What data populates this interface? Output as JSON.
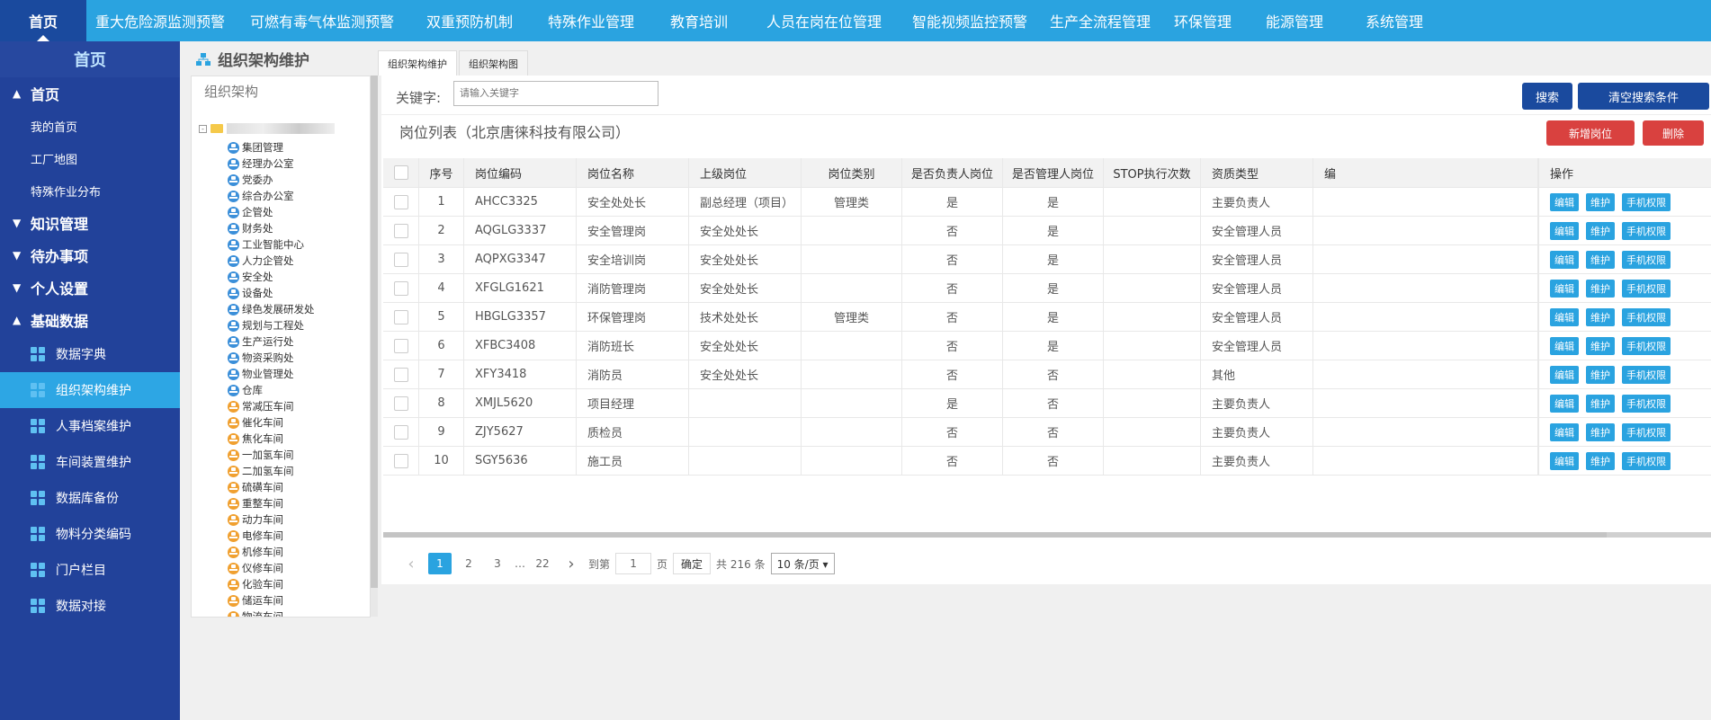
{
  "topnav": {
    "items": [
      "首页",
      "重大危险源监测预警",
      "可燃有毒气体监测预警",
      "双重预防机制",
      "特殊作业管理",
      "教育培训",
      "人员在岗在位管理",
      "智能视频监控预警",
      "生产全流程管理",
      "环保管理",
      "能源管理",
      "系统管理"
    ]
  },
  "sidebar": {
    "home": "首页",
    "group_home": "首页",
    "group_home_arrow": "▲",
    "subs": [
      "我的首页",
      "工厂地图",
      "特殊作业分布"
    ],
    "groups": [
      {
        "arrow": "▼",
        "label": "知识管理"
      },
      {
        "arrow": "▼",
        "label": "待办事项"
      },
      {
        "arrow": "▼",
        "label": "个人设置"
      },
      {
        "arrow": "▲",
        "label": "基础数据"
      }
    ],
    "items": [
      {
        "label": "数据字典",
        "icon": "dictionary-icon"
      },
      {
        "label": "组织架构维护",
        "icon": "org-chart-icon"
      },
      {
        "label": "人事档案维护",
        "icon": "folder-icon"
      },
      {
        "label": "车间装置维护",
        "icon": "building-icon"
      },
      {
        "label": "数据库备份",
        "icon": "bar-chart-icon"
      },
      {
        "label": "物料分类编码",
        "icon": "grid-icon"
      },
      {
        "label": "门户栏目",
        "icon": "list-icon"
      },
      {
        "label": "数据对接",
        "icon": "grid-icon"
      }
    ],
    "active_item_index": 1
  },
  "tree": {
    "panel_title": "组织架构维护",
    "box_header": "组织架构",
    "expander": "-",
    "nodes_blue": [
      "集团管理",
      "经理办公室",
      "党委办",
      "综合办公室",
      "企管处",
      "财务处",
      "工业智能中心",
      "人力企管处",
      "安全处",
      "设备处",
      "绿色发展研发处",
      "规划与工程处",
      "生产运行处",
      "物资采购处",
      "物业管理处",
      "仓库"
    ],
    "nodes_orange": [
      "常减压车间",
      "催化车间",
      "焦化车间",
      "一加氢车间",
      "二加氢车间",
      "硫磺车间",
      "重整车间",
      "动力车间",
      "电修车间",
      "机修车间",
      "仪修车间",
      "化验车间",
      "储运车间",
      "物流车间"
    ]
  },
  "tabs": [
    "组织架构维护",
    "组织架构图"
  ],
  "search": {
    "label": "关键字:",
    "placeholder": "请输入关键字",
    "search_button": "搜索",
    "clear_button": "清空搜索条件"
  },
  "list": {
    "title": "岗位列表（北京唐徕科技有限公司）",
    "add_button": "新增岗位",
    "delete_button": "删除"
  },
  "table": {
    "headers": [
      "序号",
      "岗位编码",
      "岗位名称",
      "上级岗位",
      "岗位类别",
      "是否负责人岗位",
      "是否管理人岗位",
      "STOP执行次数",
      "资质类型",
      "编",
      "操作"
    ],
    "op_labels": [
      "编辑",
      "维护",
      "手机权限"
    ],
    "rows": [
      [
        "1",
        "AHCC3325",
        "安全处处长",
        "副总经理（项目）",
        "管理类",
        "是",
        "是",
        "",
        "主要负责人"
      ],
      [
        "2",
        "AQGLG3337",
        "安全管理岗",
        "安全处处长",
        "",
        "否",
        "是",
        "",
        "安全管理人员"
      ],
      [
        "3",
        "AQPXG3347",
        "安全培训岗",
        "安全处处长",
        "",
        "否",
        "是",
        "",
        "安全管理人员"
      ],
      [
        "4",
        "XFGLG1621",
        "消防管理岗",
        "安全处处长",
        "",
        "否",
        "是",
        "",
        "安全管理人员"
      ],
      [
        "5",
        "HBGLG3357",
        "环保管理岗",
        "技术处处长",
        "管理类",
        "否",
        "是",
        "",
        "安全管理人员"
      ],
      [
        "6",
        "XFBC3408",
        "消防班长",
        "安全处处长",
        "",
        "否",
        "是",
        "",
        "安全管理人员"
      ],
      [
        "7",
        "XFY3418",
        "消防员",
        "安全处处长",
        "",
        "否",
        "否",
        "",
        "其他"
      ],
      [
        "8",
        "XMJL5620",
        "项目经理",
        "",
        "",
        "是",
        "否",
        "",
        "主要负责人"
      ],
      [
        "9",
        "ZJY5627",
        "质检员",
        "",
        "",
        "否",
        "否",
        "",
        "主要负责人"
      ],
      [
        "10",
        "SGY5636",
        "施工员",
        "",
        "",
        "否",
        "否",
        "",
        "主要负责人"
      ]
    ]
  },
  "pager": {
    "prev": "‹",
    "pages": [
      "1",
      "2",
      "3"
    ],
    "ellipsis": "…",
    "last": "22",
    "next": "›",
    "goto_label": "到第",
    "goto_value": "1",
    "page_unit": "页",
    "confirm": "确定",
    "total": "共 216 条",
    "page_size": "10 条/页 ▾"
  },
  "colors": {
    "topnav": "#2aa3e0",
    "sidebar": "#22429a",
    "active": "#2da6e4",
    "navy_button": "#1a4a9e",
    "red_button": "#d9413f"
  }
}
